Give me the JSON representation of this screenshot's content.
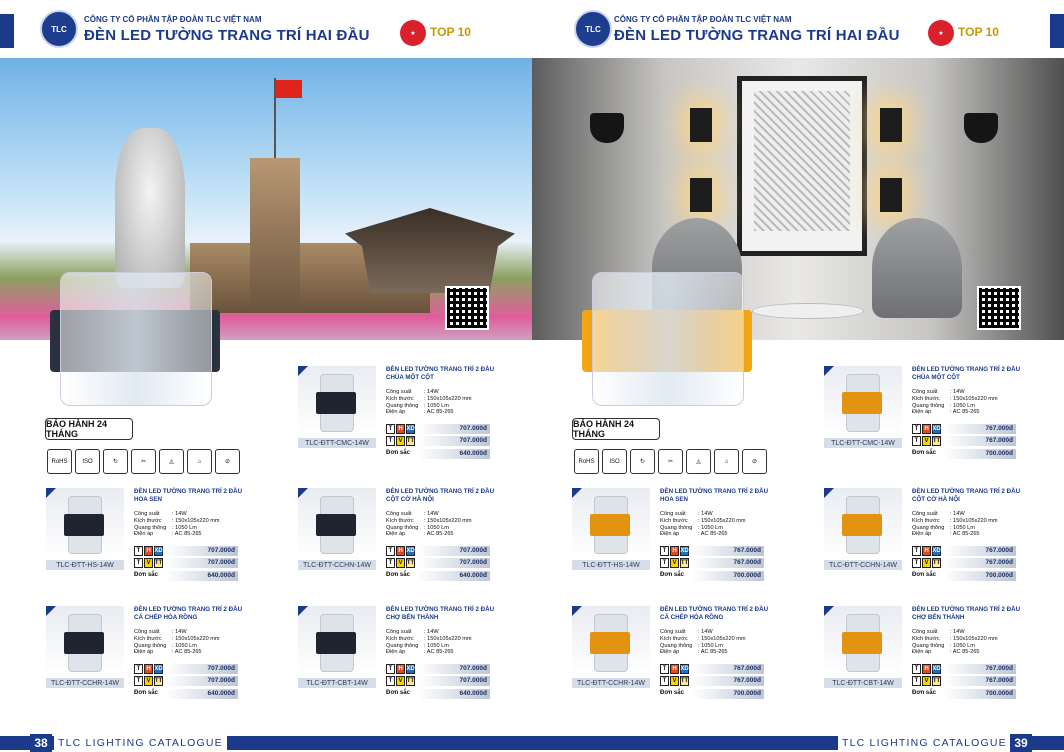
{
  "header": {
    "company": "CÔNG TY CỔ PHẦN TẬP ĐOÀN TLC VIỆT NAM",
    "title": "ĐÈN LED TƯỜNG TRANG TRÍ HAI ĐẦU",
    "logo_text": "TLC",
    "award_text": "TOP 10"
  },
  "warranty": "BẢO HÀNH 24 THÁNG",
  "certs": [
    "RoHS",
    "ISO",
    "↻",
    "✂",
    "◬",
    "⌂",
    "⊘"
  ],
  "price_letters": [
    "T",
    "H",
    "XD",
    "T",
    "V",
    "TT"
  ],
  "color_label": "Đơn sắc",
  "spec_labels": [
    "Công suất",
    "Kích thước",
    "Quang thông",
    "Điện áp"
  ],
  "spec_values": [
    ": 14W",
    ": 150x105x220 mm",
    ": 1050 Lm",
    ": AC 85-265"
  ],
  "left": {
    "page_number": "38",
    "footer_text": "TLC LIGHTING CATALOGUE",
    "products": [
      {
        "name": "ĐÈN LED TƯỜNG TRANG TRÍ 2 ĐẦU CHÙA MỘT CỘT",
        "code": "TLC-ĐTT-CMC-14W",
        "p1": "707.000đ",
        "p2": "707.000đ",
        "p3": "640.000đ"
      },
      {
        "name": "ĐÈN LED TƯỜNG TRANG TRÍ 2 ĐẦU HOA SEN",
        "code": "TLC-ĐTT-HS-14W",
        "p1": "707.000đ",
        "p2": "707.000đ",
        "p3": "640.000đ"
      },
      {
        "name": "ĐÈN LED TƯỜNG TRANG TRÍ 2 ĐẦU CỘT CỜ HÀ NỘI",
        "code": "TLC-ĐTT-CCHN-14W",
        "p1": "707.000đ",
        "p2": "707.000đ",
        "p3": "640.000đ"
      },
      {
        "name": "ĐÈN LED TƯỜNG TRANG TRÍ 2 ĐẦU CÁ CHÉP HÓA RỒNG",
        "code": "TLC-ĐTT-CCHR-14W",
        "p1": "707.000đ",
        "p2": "707.000đ",
        "p3": "640.000đ"
      },
      {
        "name": "ĐÈN LED TƯỜNG TRANG TRÍ 2 ĐẦU CHỢ BẾN THÀNH",
        "code": "TLC-ĐTT-CBT-14W",
        "p1": "707.000đ",
        "p2": "707.000đ",
        "p3": "640.000đ"
      }
    ]
  },
  "right": {
    "page_number": "39",
    "footer_text": "TLC LIGHTING CATALOGUE",
    "products": [
      {
        "name": "ĐÈN LED TƯỜNG TRANG TRÍ 2 ĐẦU CHÙA MỘT CỘT",
        "code": "TLC-ĐTT-CMC-14W",
        "p1": "767.000đ",
        "p2": "767.000đ",
        "p3": "700.000đ"
      },
      {
        "name": "ĐÈN LED TƯỜNG TRANG TRÍ 2 ĐẦU HOA SEN",
        "code": "TLC-ĐTT-HS-14W",
        "p1": "767.000đ",
        "p2": "767.000đ",
        "p3": "700.000đ"
      },
      {
        "name": "ĐÈN LED TƯỜNG TRANG TRÍ 2 ĐẦU CỘT CỜ HÀ NỘI",
        "code": "TLC-ĐTT-CCHN-14W",
        "p1": "767.000đ",
        "p2": "767.000đ",
        "p3": "700.000đ"
      },
      {
        "name": "ĐÈN LED TƯỜNG TRANG TRÍ 2 ĐẦU CÁ CHÉP HÓA RỒNG",
        "code": "TLC-ĐTT-CCHR-14W",
        "p1": "767.000đ",
        "p2": "767.000đ",
        "p3": "700.000đ"
      },
      {
        "name": "ĐÈN LED TƯỜNG TRANG TRÍ 2 ĐẦU CHỢ BẾN THÀNH",
        "code": "TLC-ĐTT-CBT-14W",
        "p1": "767.000đ",
        "p2": "767.000đ",
        "p3": "700.000đ"
      }
    ]
  },
  "colors": {
    "brand_blue": "#1b3a8a",
    "band_black": "#1f2530",
    "band_gold": "#e2930f",
    "sq_t": "#ffffff",
    "sq_h": "#e04a1e",
    "sq_xd": "#1e6fbf",
    "sq_v": "#f5d400",
    "sq_tt": "#ffe89a"
  }
}
